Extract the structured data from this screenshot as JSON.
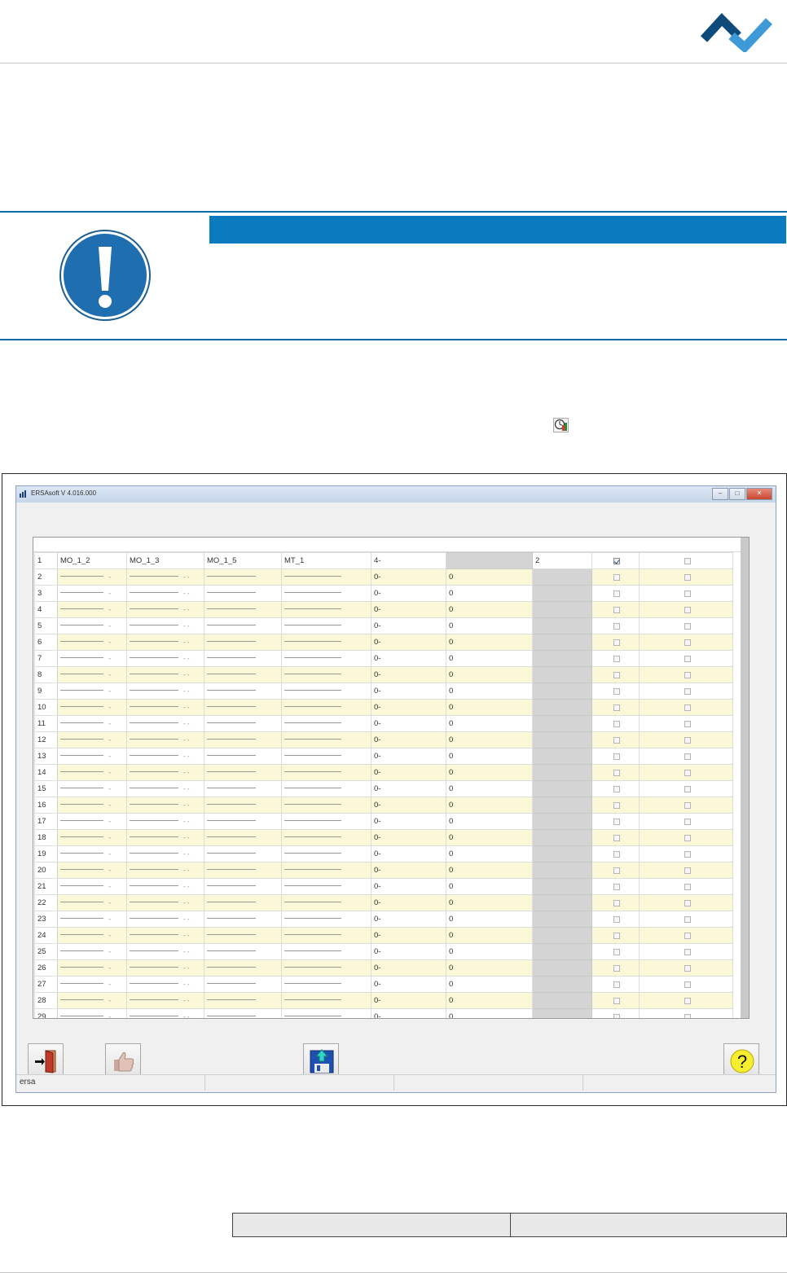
{
  "window": {
    "title": "ERSAsoft V 4.016.000",
    "controls": {
      "minimize": "‒",
      "maximize": "□",
      "close": "✕"
    }
  },
  "grid": {
    "row1": [
      "1",
      "MO_1_2",
      "MO_1_3",
      "MO_1_5",
      "MT_1",
      "4-",
      "",
      "2"
    ],
    "row_numbers": [
      "2",
      "3",
      "4",
      "5",
      "6",
      "7",
      "8",
      "9",
      "10",
      "11",
      "12",
      "13",
      "14",
      "15",
      "16",
      "17",
      "18",
      "19",
      "20",
      "21",
      "22",
      "23",
      "24",
      "25",
      "26",
      "27",
      "28",
      "29"
    ],
    "default_col5": "0-",
    "default_col6": "0",
    "checked": {
      "row": 1,
      "col": 1
    }
  },
  "toolbar": {
    "exit": "exit-door-icon",
    "accept": "thumbs-up-icon",
    "save": "save-disk-icon",
    "help": "?"
  },
  "statusbar": {
    "cell1": "ersa",
    "cell2": "",
    "cell3": "",
    "cell4": ""
  },
  "colors": {
    "brand_dark": "#0e4a7a",
    "brand_light": "#3d9ad6",
    "notice_bar": "#0b7bbf",
    "row_alt": "#fbf8d8"
  }
}
